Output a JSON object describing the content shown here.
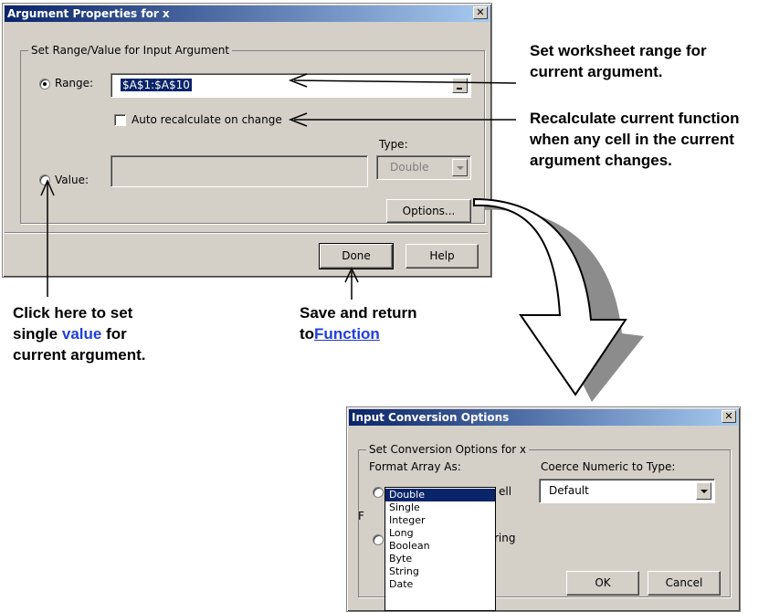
{
  "arg_dialog": {
    "title": "Argument Properties for x",
    "close_label": "✕",
    "group_label": "Set Range/Value for Input Argument",
    "range_label": "Range:",
    "range_value": "$A$1:$A$10",
    "auto_recalc_label": "Auto recalculate on change",
    "type_label": "Type:",
    "type_value": "Double",
    "value_label": "Value:",
    "value_value": "",
    "options_button": "Options...",
    "done_button": "Done",
    "help_button": "Help"
  },
  "conv_dialog": {
    "title": "Input Conversion Options",
    "close_label": "✕",
    "group_label": "Set Conversion Options for x",
    "format_array_label": "Format Array As:",
    "cell_label": "ell",
    "coerce_label": "Coerce Numeric to Type:",
    "coerce_value": "Default",
    "format_label_partial": "F",
    "string_label_partial": "ring",
    "dropdown_options": [
      "Double",
      "Single",
      "Integer",
      "Long",
      "Boolean",
      "Byte",
      "String",
      "Date"
    ],
    "dropdown_selected": "Double",
    "ok_button": "OK",
    "cancel_button": "Cancel"
  },
  "annotations": {
    "range_note": "Set worksheet range for current argument.",
    "recalc_note": "Recalculate current function when any cell in the current argument changes.",
    "value_note_before": "Click here to set single ",
    "value_note_highlight": "value",
    "value_note_after": " for current argument.",
    "done_note_line1": "Save and return",
    "done_note_prefix": "to",
    "done_note_link": "Function"
  },
  "colors": {
    "titlebar_start": "#0a246a",
    "titlebar_end": "#a6caf0",
    "highlight_text": "#1f3fd6",
    "dialog_face": "#d4d0c8"
  }
}
